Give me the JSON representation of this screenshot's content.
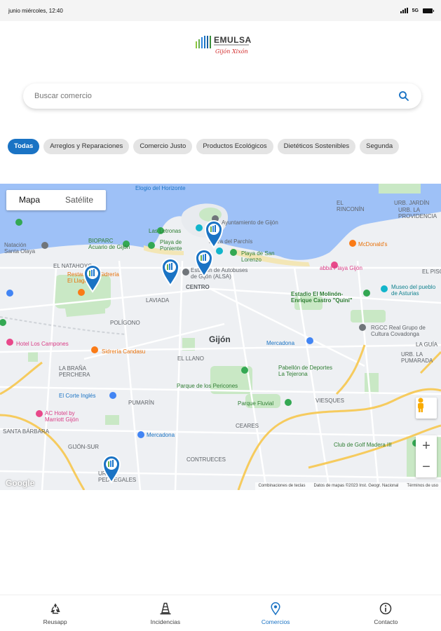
{
  "status_bar": {
    "time": "junio miércoles, 12:40",
    "network": "5G"
  },
  "logo": {
    "name": "EMULSA",
    "script": "Gijón Xixón"
  },
  "search": {
    "placeholder": "Buscar comercio"
  },
  "categories": [
    {
      "label": "Todas",
      "active": true
    },
    {
      "label": "Arreglos y Reparaciones",
      "active": false
    },
    {
      "label": "Comercio Justo",
      "active": false
    },
    {
      "label": "Productos Ecológicos",
      "active": false
    },
    {
      "label": "Dietéticos Sostenibles",
      "active": false
    },
    {
      "label": "Segunda",
      "active": false
    }
  ],
  "map": {
    "tab_map": "Mapa",
    "tab_satellite": "Satélite",
    "zoom_in": "+",
    "zoom_out": "−",
    "google": "Google",
    "attribution": [
      "Combinaciones de teclas",
      "Datos de mapas ©2023 Inst. Geogr. Nacional",
      "Términos de uso"
    ],
    "labels": {
      "elogio": "Elogio del Horizonte",
      "ayuntamiento": "Ayuntamiento de Gijón",
      "letronas": "Las Letronas",
      "biopark": "BIOPARC\nAcuario de Gijón",
      "poniente": "Playa de\nPoniente",
      "parchis": "Plaza del Parchís",
      "natacion": "Natación\nSanta Olaya",
      "san_lorenzo": "Playa de San\nLorenzo",
      "mcdonalds": "McDonald's",
      "abba": "abba Playa Gijón",
      "rinconin": "EL\nRINCONÍN",
      "urb_jardin": "URB. JARDÍN",
      "providencia": "URB. LA\nPROVIDENCIA",
      "el_piso": "EL PISÓ",
      "natahoyo": "EL NATAHOYO",
      "sidreria": "Restaurante Sidrería\nEl Llagar",
      "estacion": "Estación de Autobuses\nde Gijón (ALSA)",
      "centro": "CENTRO",
      "molinon": "Estadio El Molinón-\nEnrique Castro \"Quini\"",
      "museo": "Museo del pueblo\nde Asturias",
      "laviada": "LAVIADA",
      "poligono": "POLÍGONO",
      "rgcc": "RGCC Real Grupo de\nCultura Covadonga",
      "campones": "Hotel Los Campones",
      "candasu": "Sidrería Candasu",
      "gijon": "Gijón",
      "mercadona1": "Mercadona",
      "la_guia": "LA GUÍA",
      "pumarida": "URB. LA\nPUMARADA",
      "el_llano": "EL LLANO",
      "brana": "LA BRAÑA\nPERCHERA",
      "pabellon": "Pabellón de Deportes\nLa Tejerona",
      "corte": "El Corte Inglés",
      "pericones": "Parque de los Pericones",
      "fluvial": "Parque Fluvial",
      "viesques": "VIESQUES",
      "pumarin": "PUMARÍN",
      "ac_hotel": "AC Hotel by\nMarriott Gijón",
      "santa_barbara": "SANTA BÁRBARA",
      "ceares": "CEARES",
      "mercadona2": "Mercadona",
      "gijon_sur": "GIJÓN-SUR",
      "golf": "Club de Golf Madera III",
      "contrueces": "CONTRUECES",
      "pedregales": "URB\nPEDREGALES"
    }
  },
  "bottom_nav": [
    {
      "label": "Reusapp",
      "icon": "recycle-icon",
      "active": false
    },
    {
      "label": "Incidencias",
      "icon": "traffic-cone-icon",
      "active": false
    },
    {
      "label": "Comercios",
      "icon": "location-pin-icon",
      "active": true
    },
    {
      "label": "Contacto",
      "icon": "info-icon",
      "active": false
    }
  ],
  "colors": {
    "accent": "#1a73c4",
    "sea": "#9ec1f7",
    "park": "#c9e8c5",
    "road_major": "#f6cb5e",
    "land": "#eef0f3"
  }
}
